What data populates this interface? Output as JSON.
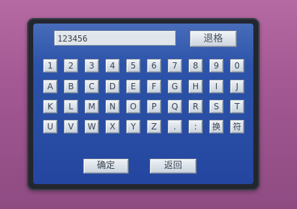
{
  "input": {
    "value": "123456"
  },
  "buttons": {
    "back": "退格",
    "confirm": "确定",
    "return": "返回"
  },
  "keys": {
    "row1": [
      "1",
      "2",
      "3",
      "4",
      "5",
      "6",
      "7",
      "8",
      "9",
      "0"
    ],
    "row2": [
      "A",
      "B",
      "C",
      "D",
      "E",
      "F",
      "G",
      "H",
      "I",
      "J"
    ],
    "row3": [
      "K",
      "L",
      "M",
      "N",
      "O",
      "P",
      "Q",
      "R",
      "S",
      "T"
    ],
    "row4": [
      "U",
      "V",
      "W",
      "X",
      "Y",
      "Z",
      ".",
      ":",
      "换",
      "符"
    ]
  }
}
